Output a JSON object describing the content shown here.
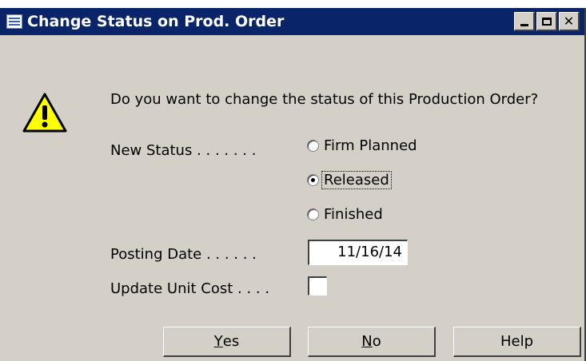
{
  "window": {
    "title": "Change Status on Prod. Order"
  },
  "dialog": {
    "prompt": "Do you want to change the status of this Production Order?",
    "new_status_label": "New Status . . . . . . .",
    "status_options": [
      "Firm Planned",
      "Released",
      "Finished"
    ],
    "selected_status": "Released",
    "posting_date_label": "Posting Date . . . . . .",
    "posting_date_value": "11/16/14",
    "update_unit_cost_label": "Update Unit Cost . . . .",
    "update_unit_cost_checked": false
  },
  "buttons": {
    "yes_mnemonic": "Y",
    "yes_rest": "es",
    "no_mnemonic": "N",
    "no_rest": "o",
    "help_label": "Help"
  },
  "icons": {
    "title": "table-icon",
    "warning": "warning-icon"
  },
  "colors": {
    "titlebar": "#0a246a",
    "dialog_bg": "#d4d0c8",
    "warning_fill": "#ffff00"
  }
}
